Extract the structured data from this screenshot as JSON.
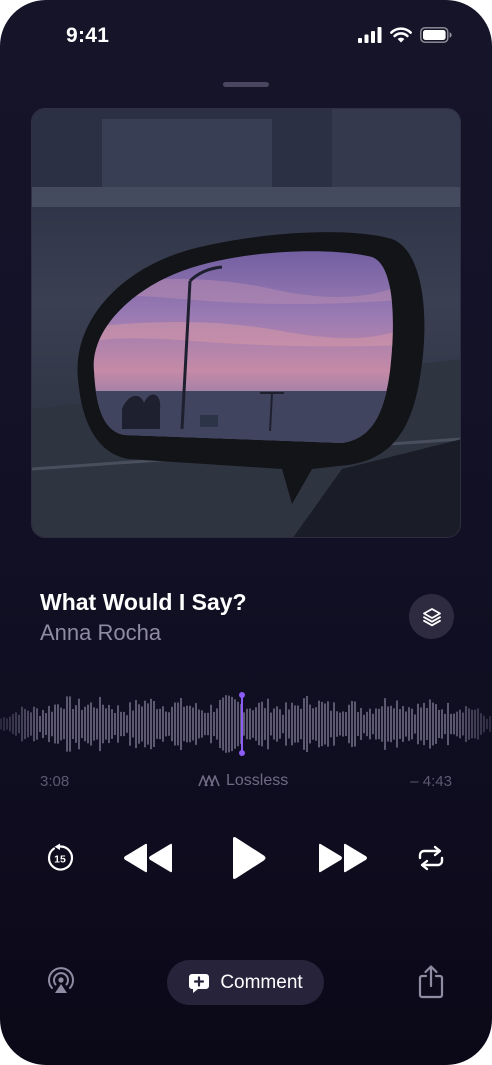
{
  "status_bar": {
    "time": "9:41",
    "icons": [
      "cellular-signal-icon",
      "wifi-icon",
      "battery-icon"
    ]
  },
  "now_playing": {
    "title": "What Would I Say?",
    "artist": "Anna Rocha",
    "artwork": "car side mirror reflecting a purple sunset sky"
  },
  "playback": {
    "elapsed": "3:08",
    "remaining": "– 4:43",
    "quality_label": "Lossless",
    "quality_icon": "lossless-icon",
    "progress": 0.43
  },
  "controls": {
    "skip_back_icon": "skip-back-15-icon",
    "skip_back_seconds": "15",
    "rewind_icon": "rewind-icon",
    "play_icon": "play-icon",
    "fast_forward_icon": "fast-forward-icon",
    "repeat_icon": "repeat-icon"
  },
  "bottom_bar": {
    "airplay_icon": "airplay-audio-icon",
    "comment_label": "Comment",
    "comment_icon": "comment-plus-icon",
    "share_icon": "share-icon"
  },
  "colors": {
    "background": "#141227",
    "accent_playhead": "#8b5cf6",
    "waveform": "#5c5870",
    "secondary_text": "#8f8ba3",
    "pill_background": "#26233a"
  }
}
